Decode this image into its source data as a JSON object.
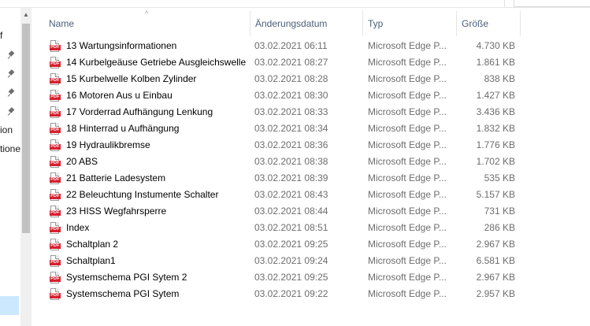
{
  "navigation": {
    "fragments": [
      "f",
      "ion",
      "tione"
    ],
    "pinned_count": 4
  },
  "columns": {
    "name": "Name",
    "date": "Änderungsdatum",
    "type": "Typ",
    "size": "Größe"
  },
  "file_icon_label": "PDF",
  "files": [
    {
      "name": "13 Wartungsinformationen",
      "date": "03.02.2021 06:11",
      "type": "Microsoft Edge P...",
      "size": "4.730 KB"
    },
    {
      "name": "14 Kurbelgeäuse Getriebe Ausgleichswelle",
      "date": "03.02.2021 08:27",
      "type": "Microsoft Edge P...",
      "size": "1.861 KB"
    },
    {
      "name": "15 Kurbelwelle Kolben Zylinder",
      "date": "03.02.2021 08:28",
      "type": "Microsoft Edge P...",
      "size": "838 KB"
    },
    {
      "name": "16 Motoren Aus u Einbau",
      "date": "03.02.2021 08:30",
      "type": "Microsoft Edge P...",
      "size": "1.427 KB"
    },
    {
      "name": "17 Vorderrad Aufhängung Lenkung",
      "date": "03.02.2021 08:33",
      "type": "Microsoft Edge P...",
      "size": "3.436 KB"
    },
    {
      "name": "18 Hinterrad u Aufhängung",
      "date": "03.02.2021 08:34",
      "type": "Microsoft Edge P...",
      "size": "1.832 KB"
    },
    {
      "name": "19 Hydraulikbremse",
      "date": "03.02.2021 08:36",
      "type": "Microsoft Edge P...",
      "size": "1.776 KB"
    },
    {
      "name": "20 ABS",
      "date": "03.02.2021 08:38",
      "type": "Microsoft Edge P...",
      "size": "1.702 KB"
    },
    {
      "name": "21 Batterie Ladesystem",
      "date": "03.02.2021 08:39",
      "type": "Microsoft Edge P...",
      "size": "535 KB"
    },
    {
      "name": "22 Beleuchtung Instumente Schalter",
      "date": "03.02.2021 08:43",
      "type": "Microsoft Edge P...",
      "size": "5.157 KB"
    },
    {
      "name": "23 HISS Wegfahrsperre",
      "date": "03.02.2021 08:44",
      "type": "Microsoft Edge P...",
      "size": "731 KB"
    },
    {
      "name": "Index",
      "date": "03.02.2021 08:51",
      "type": "Microsoft Edge P...",
      "size": "286 KB"
    },
    {
      "name": "Schaltplan 2",
      "date": "03.02.2021 09:25",
      "type": "Microsoft Edge P...",
      "size": "2.967 KB"
    },
    {
      "name": "Schaltplan1",
      "date": "03.02.2021 09:24",
      "type": "Microsoft Edge P...",
      "size": "6.581 KB"
    },
    {
      "name": "Systemschema PGI Sytem 2",
      "date": "03.02.2021 09:25",
      "type": "Microsoft Edge P...",
      "size": "2.967 KB"
    },
    {
      "name": "Systemschema PGI Sytem",
      "date": "03.02.2021 09:22",
      "type": "Microsoft Edge P...",
      "size": "2.957 KB"
    }
  ]
}
